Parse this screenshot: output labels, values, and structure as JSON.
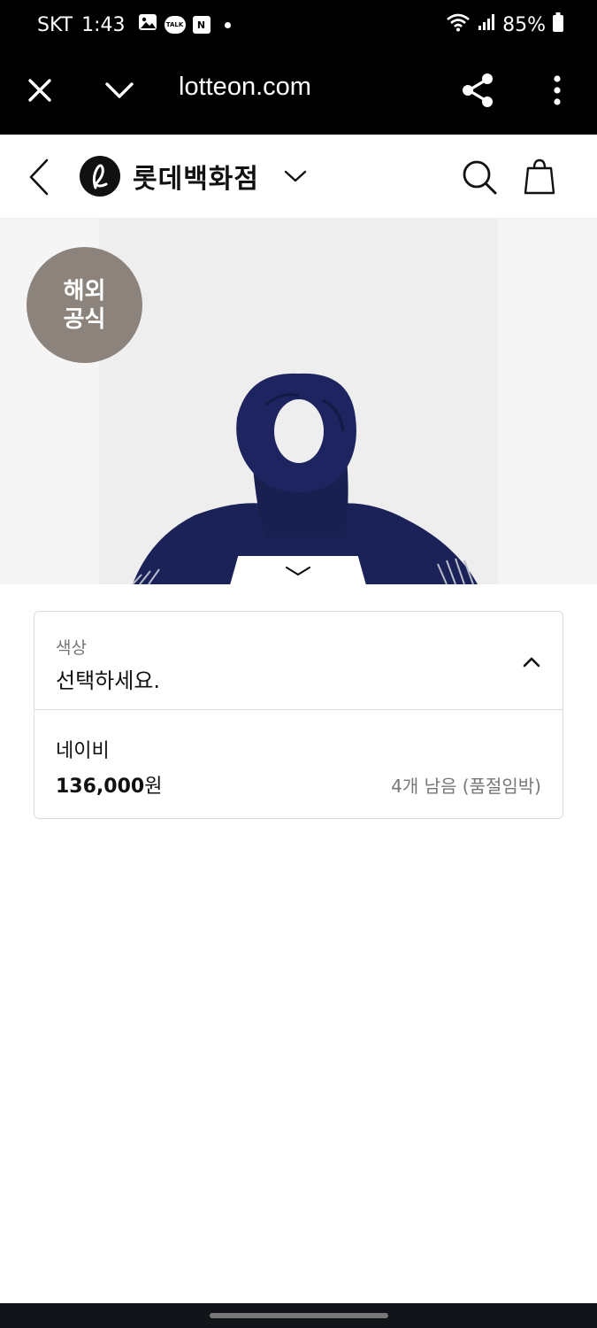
{
  "status_bar": {
    "carrier": "SKT",
    "time": "1:43",
    "talk_icon_text": "TALK",
    "n_icon_text": "N",
    "battery": "85%"
  },
  "browser": {
    "url": "lotteon.com"
  },
  "site_header": {
    "brand_name": "롯데백화점"
  },
  "product": {
    "badge_line1": "해외",
    "badge_line2": "공식"
  },
  "option_selector": {
    "label": "색상",
    "placeholder_value": "선택하세요.",
    "items": [
      {
        "name": "네이비",
        "price": "136,000",
        "currency": "원",
        "stock": "4개 남음 (품절임박)"
      }
    ]
  },
  "colors": {
    "brand_black": "#111111",
    "badge_bg": "#8c847c",
    "scarf_navy": "#1b2257",
    "border": "#dcdcdc",
    "muted_text": "#777777"
  },
  "icons": [
    "image-icon",
    "talk-icon",
    "n-icon",
    "wifi-icon",
    "signal-icon",
    "battery-icon",
    "close-icon",
    "chevron-down-icon",
    "share-icon",
    "more-vertical-icon",
    "back-icon",
    "lotte-logo-icon",
    "search-icon",
    "shopping-bag-icon",
    "chevron-up-icon"
  ]
}
